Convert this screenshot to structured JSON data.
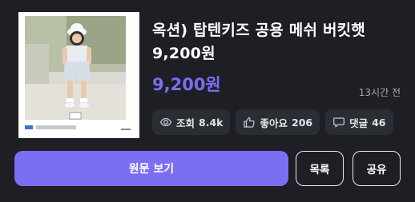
{
  "item": {
    "title_line1": "옥션) 탑텐키즈 공용 메쉬 버킷햇",
    "title_line2": "9,200원",
    "price": "9,200원",
    "time_ago": "13시간 전"
  },
  "stats": {
    "views_label": "조회",
    "views_value": "8.4k",
    "likes_label": "좋아요",
    "likes_value": "206",
    "comments_label": "댓글",
    "comments_value": "46"
  },
  "actions": {
    "view_original": "원문 보기",
    "list": "목록",
    "share": "공유"
  },
  "icons": {
    "views": "eye-icon",
    "likes": "thumbs-up-icon",
    "comments": "speech-bubble-icon"
  },
  "colors": {
    "background": "#1e1f25",
    "accent": "#7a6ef2",
    "chip": "#2b2d34"
  }
}
